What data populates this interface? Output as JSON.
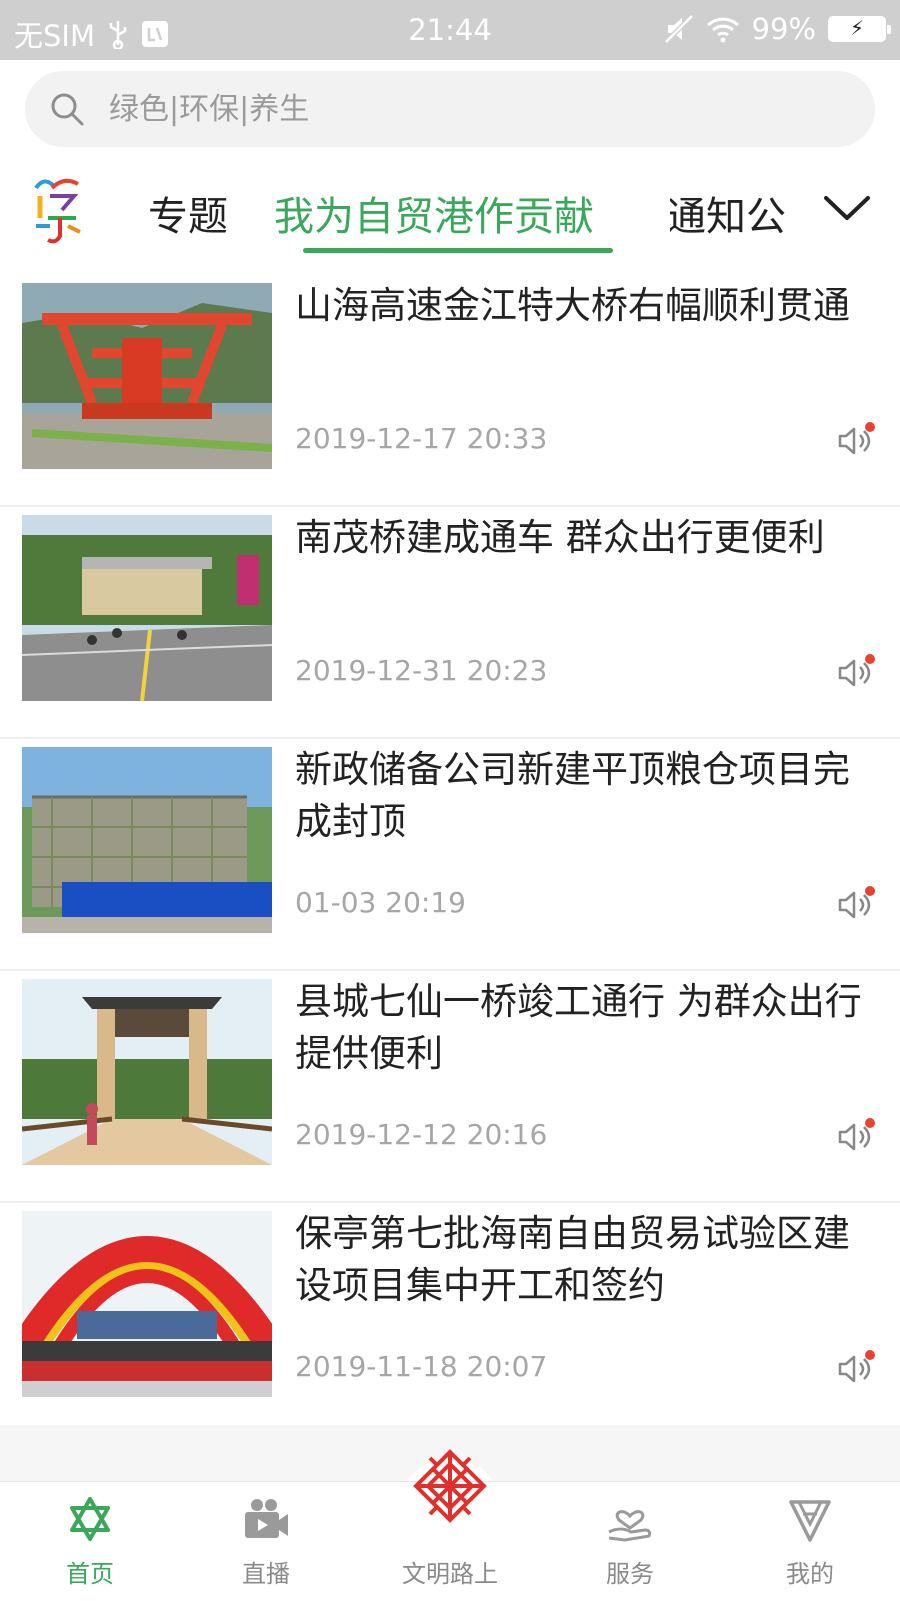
{
  "status_bar": {
    "carrier": "无SIM",
    "time": "21:44",
    "battery": "99%"
  },
  "search": {
    "placeholder": "绿色|环保|养生"
  },
  "tabs": {
    "items": [
      {
        "label": "专题"
      },
      {
        "label": "我为自贸港作贡献"
      },
      {
        "label": "通知公"
      }
    ],
    "active_index": 1
  },
  "news": [
    {
      "title": "山海高速金江特大桥右幅顺利贯通",
      "time": "2019-12-17 20:33"
    },
    {
      "title": "南茂桥建成通车 群众出行更便利",
      "time": "2019-12-31 20:23"
    },
    {
      "title": "新政储备公司新建平顶粮仓项目完成封顶",
      "time": "01-03 20:19"
    },
    {
      "title": "县城七仙一桥竣工通行 为群众出行提供便利",
      "time": "2019-12-12 20:16"
    },
    {
      "title": "保亭第七批海南自由贸易试验区建设项目集中开工和签约",
      "time": "2019-11-18 20:07"
    }
  ],
  "bottom_nav": [
    {
      "label": "首页",
      "icon": "star-of-david-icon"
    },
    {
      "label": "直播",
      "icon": "video-camera-icon"
    },
    {
      "label": "文明路上",
      "icon": "knot-emblem-icon"
    },
    {
      "label": "服务",
      "icon": "hand-heart-icon"
    },
    {
      "label": "我的",
      "icon": "diamond-profile-icon"
    }
  ],
  "colors": {
    "accent": "#3aa85a",
    "emblem": "#e0302c",
    "status_bar": "#cfcfcf"
  }
}
